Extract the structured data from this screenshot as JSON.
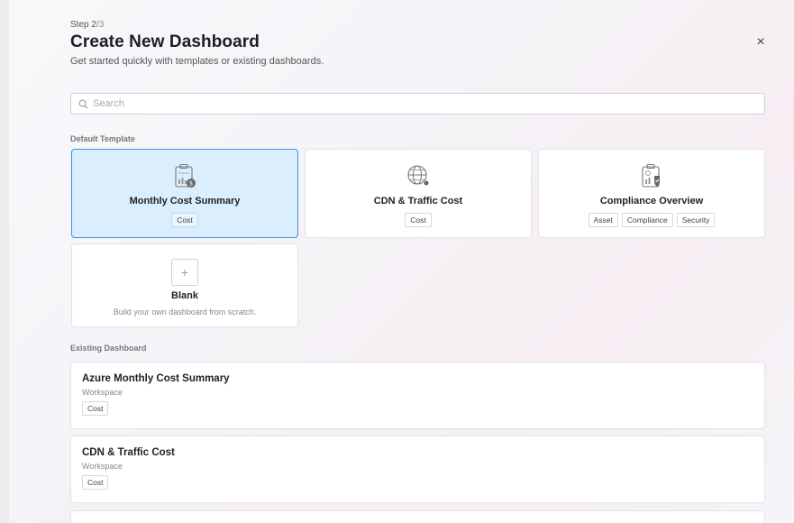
{
  "header": {
    "step_prefix": "Step 2",
    "step_total": "/3",
    "title": "Create New Dashboard",
    "subtitle": "Get started quickly with templates or existing dashboards."
  },
  "close_glyph": "×",
  "search": {
    "placeholder": "Search",
    "value": ""
  },
  "default_template": {
    "label": "Default Template",
    "cards": [
      {
        "name": "Monthly Cost Summary",
        "icon": "monthly-cost-icon",
        "tags": [
          "Cost"
        ],
        "selected": true
      },
      {
        "name": "CDN & Traffic Cost",
        "icon": "globe-network-icon",
        "tags": [
          "Cost"
        ],
        "selected": false
      },
      {
        "name": "Compliance Overview",
        "icon": "compliance-icon",
        "tags": [
          "Asset",
          "Compliance",
          "Security"
        ],
        "selected": false
      }
    ],
    "blank": {
      "name": "Blank",
      "plus": "+",
      "description": "Build your own dashboard from scratch."
    }
  },
  "existing_dashboard": {
    "label": "Existing Dashboard",
    "items": [
      {
        "name": "Azure Monthly Cost Summary",
        "scope": "Workspace",
        "tags": [
          "Cost"
        ]
      },
      {
        "name": "CDN & Traffic Cost",
        "scope": "Workspace",
        "tags": [
          "Cost"
        ]
      }
    ]
  },
  "colors": {
    "accent": "#3f90e0",
    "selected_bg": "#dbeefd"
  }
}
